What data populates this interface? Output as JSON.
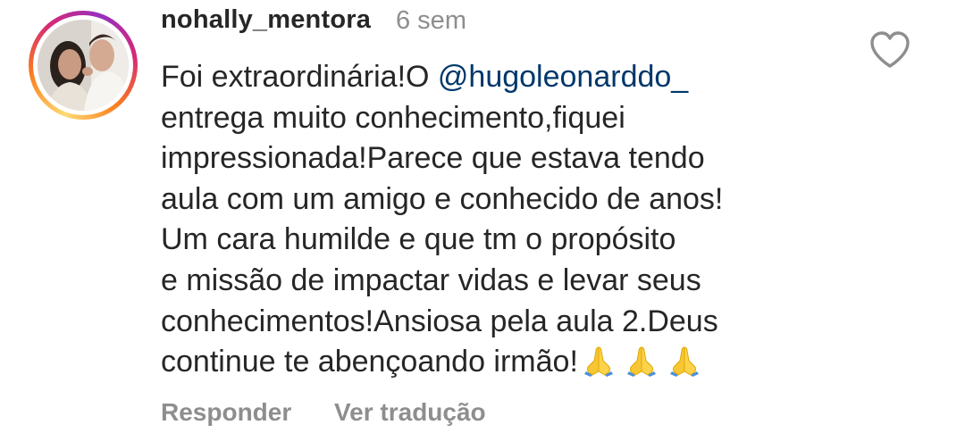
{
  "comment": {
    "username": "nohally_mentora",
    "time": "6 sem",
    "text_before_mention": "Foi extraordinária!O ",
    "mention": "@hugoleonarddo_",
    "lines": [
      "entrega muito conhecimento,fiquei",
      "impressionada!Parece que estava tendo",
      "aula com um amigo e conhecido de anos!",
      "Um cara humilde e que tm o propósito",
      "e missão de impactar vidas e levar seus",
      "conhecimentos!Ansiosa pela aula 2.Deus",
      "continue te abençoando irmão!"
    ],
    "emojis": [
      "folded-hands",
      "folded-hands",
      "folded-hands"
    ]
  },
  "actions": {
    "reply": "Responder",
    "translate": "Ver tradução"
  },
  "icons": {
    "like": "heart-outline-icon"
  },
  "colors": {
    "text": "#262626",
    "meta": "#8e8e8e",
    "mention": "#00376b"
  }
}
